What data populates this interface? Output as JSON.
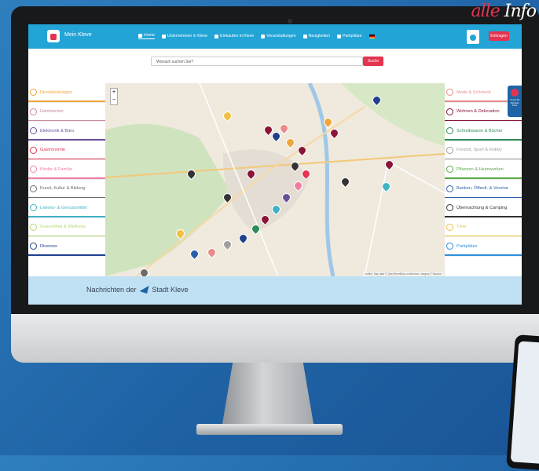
{
  "badge": {
    "part1": "alle",
    "part2": "Info"
  },
  "nav": {
    "brand": "Mein Kleve",
    "items": [
      {
        "label": "Home",
        "icon": "home-icon",
        "active": true
      },
      {
        "label": "Unternehmen in Kleve",
        "icon": "building-icon"
      },
      {
        "label": "Einkaufen in Kleve",
        "icon": "shopping-bag-icon"
      },
      {
        "label": "Veranstaltungen",
        "icon": "calendar-icon"
      },
      {
        "label": "Neuigkeiten",
        "icon": "newspaper-icon"
      },
      {
        "label": "Parkplätze",
        "icon": "parking-icon"
      }
    ],
    "login": "Eintragen"
  },
  "search": {
    "placeholder": "Wonach suchen Sie?",
    "button": "Suche"
  },
  "categories_left": [
    {
      "label": "Dienstleistungen",
      "color": "#f0a63a"
    },
    {
      "label": "Handwerker",
      "color": "#c98aa0"
    },
    {
      "label": "Elektronik & Büro",
      "color": "#6b4f9a"
    },
    {
      "label": "Gastronomie",
      "color": "#e4344f"
    },
    {
      "label": "Kinder & Familie",
      "color": "#ef7fa0"
    },
    {
      "label": "Kunst, Kultur & Bildung",
      "color": "#6b6b6b"
    },
    {
      "label": "Lebens- & Genussmittel",
      "color": "#3fb3c4"
    },
    {
      "label": "Gesundheit & Wellness",
      "color": "#b3d67a"
    },
    {
      "label": "Diverses",
      "color": "#1f3f8f"
    }
  ],
  "categories_right": [
    {
      "label": "Mode & Schmuck",
      "color": "#e98b8b"
    },
    {
      "label": "Wohnen & Dekoration",
      "color": "#8a1538"
    },
    {
      "label": "Schreibwaren & Bücher",
      "color": "#2e8b57"
    },
    {
      "label": "Freizeit, Sport & Hobby",
      "color": "#a0a0a0"
    },
    {
      "label": "Pflanzen & Heimwerken",
      "color": "#5aaa45"
    },
    {
      "label": "Banken, Öffentl. & Vereine",
      "color": "#2c5ea8"
    },
    {
      "label": "Übernachtung & Camping",
      "color": "#333333"
    },
    {
      "label": "Tiere",
      "color": "#f0c040"
    },
    {
      "label": "Parkplätze",
      "color": "#2c8fd8"
    }
  ],
  "map": {
    "zoom_in": "+",
    "zoom_out": "−",
    "attribution": "Leaflet | Map data © OpenStreetMap contributors, Imagery © Mapbox"
  },
  "covid": {
    "label": "Covid-19 Aktuelle Infos"
  },
  "news": {
    "prefix": "Nachrichten der",
    "suffix": "Stadt Kleve"
  }
}
